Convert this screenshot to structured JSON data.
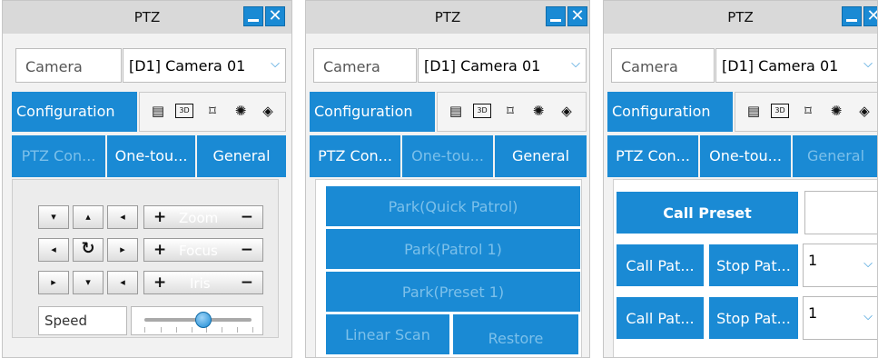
{
  "panels": [
    {
      "title": "PTZ",
      "camera_label": "Camera",
      "camera_value": "[D1] Camera 01",
      "config_tab": "Configuration",
      "tabs": [
        "PTZ Con...",
        "One-tou...",
        "General"
      ],
      "controls": {
        "zoom": "Zoom",
        "focus": "Focus",
        "iris": "Iris",
        "plus": "+",
        "minus": "−",
        "speed_label": "Speed",
        "speed_level": 0.55
      }
    },
    {
      "title": "PTZ",
      "camera_label": "Camera",
      "camera_value": "[D1] Camera 01",
      "config_tab": "Configuration",
      "tabs": [
        "PTZ Con...",
        "One-tou...",
        "General"
      ],
      "buttons": [
        "Park(Quick Patrol)",
        "Park(Patrol 1)",
        "Park(Preset 1)",
        "Linear Scan",
        "Restore"
      ]
    },
    {
      "title": "PTZ",
      "camera_label": "Camera",
      "camera_value": "[D1] Camera 01",
      "config_tab": "Configuration",
      "tabs": [
        "PTZ Con...",
        "One-tou...",
        "General"
      ],
      "call_preset": "Call Preset",
      "call_patrol": "Call Pat...",
      "stop_patrol": "Stop Pat...",
      "patrol_select_1": "1",
      "patrol_select_2": "1"
    }
  ],
  "icons": {
    "toolbar": [
      "menu-icon",
      "3d-icon",
      "zoom-area-icon",
      "light-icon",
      "wiper-icon"
    ],
    "direction": [
      "up-left-arrow",
      "up-arrow",
      "up-right-arrow",
      "left-arrow",
      "auto-scan-icon",
      "right-arrow",
      "down-left-arrow",
      "down-arrow",
      "down-right-arrow"
    ]
  },
  "colors": {
    "accent": "#1a8ad4",
    "disabled_text": "#7cc0ea"
  }
}
